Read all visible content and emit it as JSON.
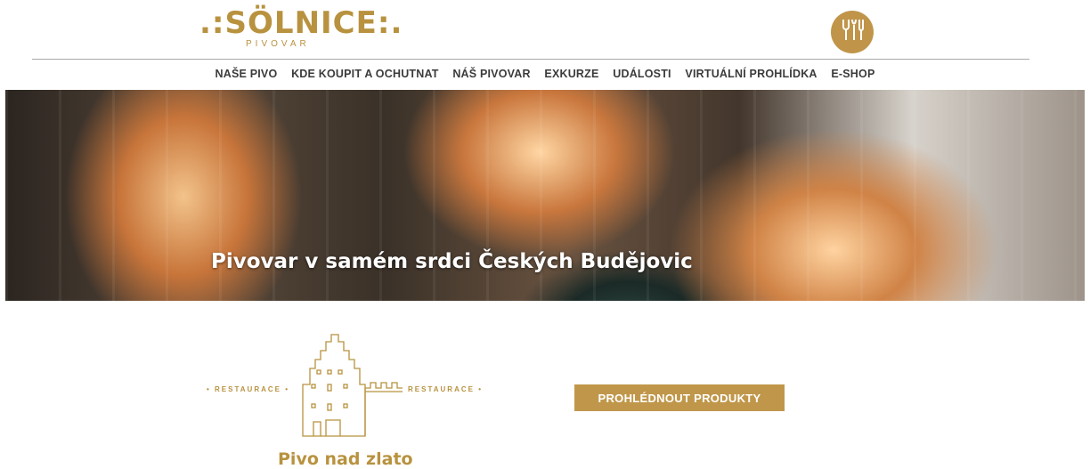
{
  "logo": {
    "main": ".:SÖLNICE:.",
    "sub": "PIVOVAR"
  },
  "menu_badge": {
    "icon": "utensils-beer-icon"
  },
  "nav": {
    "items": [
      "NAŠE PIVO",
      "KDE KOUPIT A OCHUTNAT",
      "NÁŠ PIVOVAR",
      "EXKURZE",
      "UDÁLOSTI",
      "VIRTUÁLNÍ PROHLÍDKA",
      "E-SHOP"
    ]
  },
  "hero": {
    "title": "Pivovar v samém srdci Českých Budějovic"
  },
  "restaurace": {
    "left": "• RESTAURACE •",
    "right": "RESTAURACE •",
    "brand": "Pivo nad zlato"
  },
  "cta": {
    "label": "PROHLÉDNOUT PRODUKTY"
  },
  "colors": {
    "gold": "#b8923f",
    "button": "#c0974a"
  }
}
